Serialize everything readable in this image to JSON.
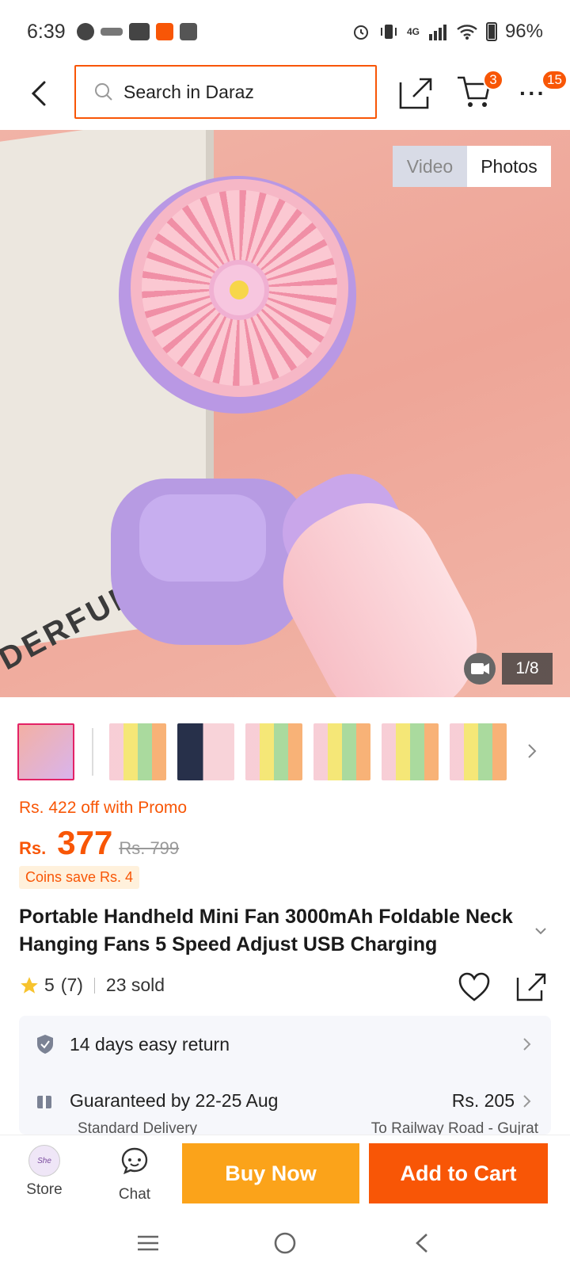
{
  "status_bar": {
    "time": "6:39",
    "network": "4G",
    "battery": "96%"
  },
  "header": {
    "search_placeholder": "Search in Daraz",
    "cart_badge": "3",
    "more_badge": "15"
  },
  "gallery": {
    "tabs": [
      "Video",
      "Photos"
    ],
    "active_tab": "Photos",
    "counter": "1/8",
    "image_caption_text": "DERFUL HOMEW",
    "thumbnail_count": 7
  },
  "pricing": {
    "promo": "Rs. 422 off with Promo",
    "currency": "Rs.",
    "price": "377",
    "original_price": "Rs. 799",
    "coins": "Coins save Rs. 4"
  },
  "product": {
    "title": "Portable Handheld Mini Fan 3000mAh Foldable Neck Hanging Fans 5 Speed Adjust USB Charging",
    "rating": "5",
    "reviews": "(7)",
    "sold": "23 sold"
  },
  "info": {
    "return": "14 days easy return",
    "delivery": "Guaranteed by 22-25 Aug",
    "delivery_price": "Rs. 205",
    "delivery_type": "Standard Delivery",
    "delivery_to": "To Railway Road - Gujrat"
  },
  "bottom_bar": {
    "store": "Store",
    "chat": "Chat",
    "buy_now": "Buy Now",
    "add_to_cart": "Add to Cart"
  },
  "colors": {
    "accent": "#f85606",
    "buy_now": "#fba31a",
    "star": "#f7c32e"
  }
}
